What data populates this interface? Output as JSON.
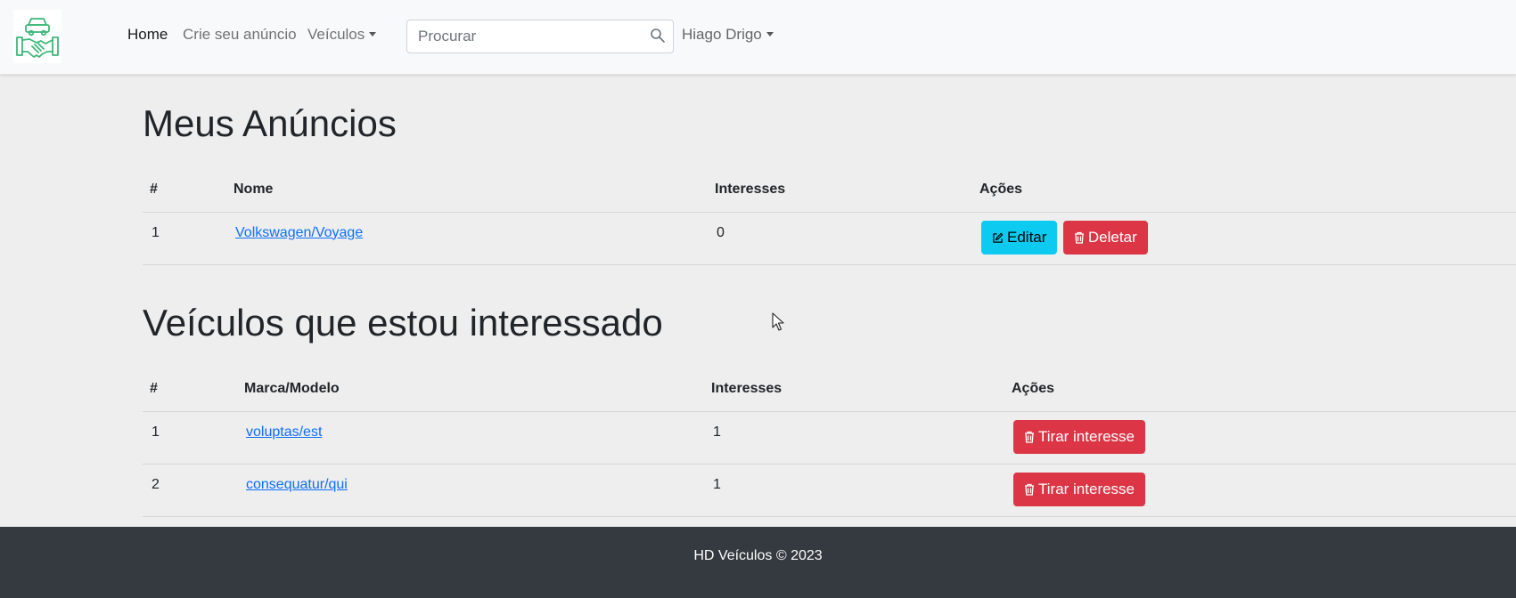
{
  "navbar": {
    "logo_alt": "HD Veículos logo",
    "links": [
      {
        "label": "Home",
        "active": true
      },
      {
        "label": "Crie seu anúncio",
        "active": false
      },
      {
        "label": "Veículos",
        "dropdown": true
      }
    ],
    "search": {
      "placeholder": "Procurar",
      "value": ""
    },
    "user": {
      "label": "Hiago Drigo",
      "dropdown": true
    }
  },
  "my_ads": {
    "title": "Meus Anúncios",
    "columns": [
      "#",
      "Nome",
      "Interesses",
      "Ações"
    ],
    "rows": [
      {
        "index": "1",
        "name": "Volkswagen/Voyage",
        "interests": "0",
        "edit_label": "Editar",
        "delete_label": "Deletar"
      }
    ]
  },
  "interested": {
    "title": "Veículos que estou interessado",
    "columns": [
      "#",
      "Marca/Modelo",
      "Interesses",
      "Ações"
    ],
    "rows": [
      {
        "index": "1",
        "model": "voluptas/est",
        "interests": "1",
        "action_label": "Tirar interesse"
      },
      {
        "index": "2",
        "model": "consequatur/qui",
        "interests": "1",
        "action_label": "Tirar interesse"
      }
    ]
  },
  "footer": {
    "text": "HD Veículos © 2023"
  },
  "colors": {
    "navbar_bg": "#f8f9fa",
    "page_bg": "#eeeeee",
    "info": "#0dcaf0",
    "danger": "#dc3545",
    "link": "#0d6efd",
    "footer_bg": "#343a40",
    "logo_green": "#3cb878"
  }
}
